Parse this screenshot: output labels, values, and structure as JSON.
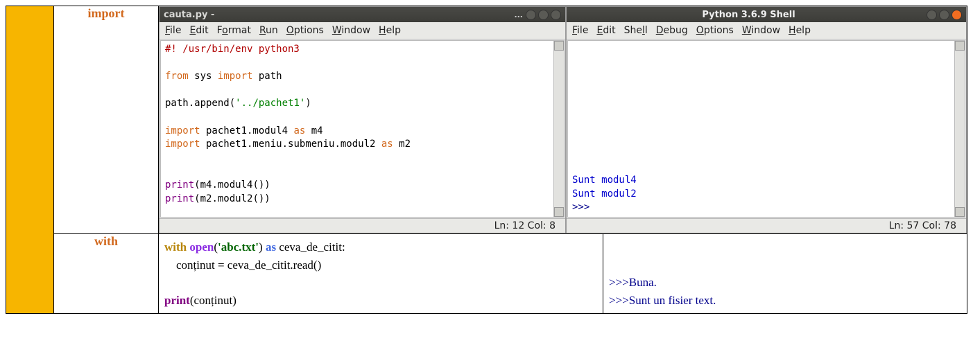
{
  "row1": {
    "label": "import",
    "editor_left": {
      "title": "cauta.py -",
      "title_dots": "...",
      "menus": [
        "File",
        "Edit",
        "Format",
        "Run",
        "Options",
        "Window",
        "Help"
      ],
      "code": {
        "l1": "#! /usr/bin/env python3",
        "l2a": "from",
        "l2b": " sys ",
        "l2c": "import",
        "l2d": " path",
        "l3a": "path.append(",
        "l3b": "'../pachet1'",
        "l3c": ")",
        "l4a": "import",
        "l4b": " pachet1.modul4 ",
        "l4c": "as",
        "l4d": " m4",
        "l5a": "import",
        "l5b": " pachet1.meniu.submeniu.modul2 ",
        "l5c": "as",
        "l5d": " m2",
        "l6a": "print",
        "l6b": "(m4.modul4())",
        "l7a": "print",
        "l7b": "(m2.modul2())"
      },
      "status": "Ln: 12  Col: 8"
    },
    "editor_right": {
      "title": "Python 3.6.9 Shell",
      "menus": [
        "File",
        "Edit",
        "Shell",
        "Debug",
        "Options",
        "Window",
        "Help"
      ],
      "out1": "Sunt modul4",
      "out2": "Sunt modul2",
      "prompt": ">>> ",
      "status": "Ln: 57  Col: 78"
    }
  },
  "row2": {
    "label": "with",
    "code": {
      "w": "with",
      "sp1": " ",
      "open": "open",
      "lp": "(",
      "str": "'abc.txt'",
      "rp": ") ",
      "as": "as",
      "rest1": " ceva_de_citit:",
      "line2": "    conținut = ceva_de_citit.read()",
      "blank": "",
      "print": "print",
      "printarg": "(conținut)"
    },
    "output": {
      "blank": "",
      "l1p": ">>>",
      "l1t": "Buna.",
      "l2p": ">>>",
      "l2t": "Sunt un fisier text."
    }
  }
}
